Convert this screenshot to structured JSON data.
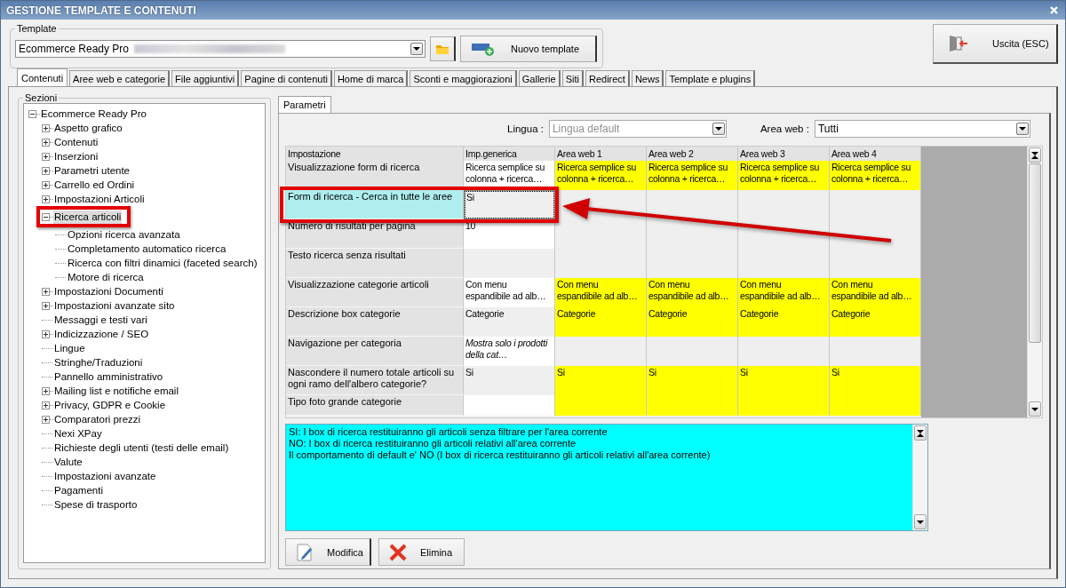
{
  "window": {
    "title": "GESTIONE TEMPLATE E CONTENUTI"
  },
  "template": {
    "label": "Template",
    "value": "Ecommerce Ready Pro"
  },
  "toolbar": {
    "new_template": "Nuovo template",
    "exit": "Uscita (ESC)"
  },
  "tabs": [
    {
      "label": "Contenuti",
      "selected": true
    },
    {
      "label": "Aree web e categorie",
      "selected": false
    },
    {
      "label": "File aggiuntivi",
      "selected": false
    },
    {
      "label": "Pagine di contenuti",
      "selected": false
    },
    {
      "label": "Home di marca",
      "selected": false
    },
    {
      "label": "Sconti e maggiorazioni",
      "selected": false
    },
    {
      "label": "Gallerie",
      "selected": false
    },
    {
      "label": "Siti",
      "selected": false
    },
    {
      "label": "Redirect",
      "selected": false
    },
    {
      "label": "News",
      "selected": false
    },
    {
      "label": "Template e plugins",
      "selected": false
    }
  ],
  "sections": {
    "label": "Sezioni",
    "tree": [
      {
        "label": "Ecommerce Ready Pro",
        "kind": "group",
        "expanded": true,
        "selected": false,
        "children": [
          {
            "label": "Aspetto grafico",
            "kind": "group",
            "expanded": false,
            "selected": false
          },
          {
            "label": "Contenuti",
            "kind": "group",
            "expanded": false,
            "selected": false
          },
          {
            "label": "Inserzioni",
            "kind": "group",
            "expanded": false,
            "selected": false
          },
          {
            "label": "Parametri utente",
            "kind": "group",
            "expanded": false,
            "selected": false
          },
          {
            "label": "Carrello ed Ordini",
            "kind": "group",
            "expanded": false,
            "selected": false
          },
          {
            "label": "Impostazioni Articoli",
            "kind": "group",
            "expanded": false,
            "selected": false
          },
          {
            "label": "Ricerca articoli",
            "kind": "group",
            "expanded": true,
            "selected": true,
            "children": [
              {
                "label": "Opzioni ricerca avanzata",
                "kind": "leaf",
                "selected": false
              },
              {
                "label": "Completamento automatico ricerca",
                "kind": "leaf",
                "selected": false
              },
              {
                "label": "Ricerca con filtri dinamici (faceted search)",
                "kind": "leaf",
                "selected": false
              },
              {
                "label": "Motore di ricerca",
                "kind": "leaf",
                "selected": false
              }
            ]
          },
          {
            "label": "Impostazioni Documenti",
            "kind": "group",
            "expanded": false,
            "selected": false
          },
          {
            "label": "Impostazioni avanzate sito",
            "kind": "group",
            "expanded": false,
            "selected": false
          },
          {
            "label": "Messaggi e testi vari",
            "kind": "leaf",
            "selected": false
          },
          {
            "label": "Indicizzazione / SEO",
            "kind": "group",
            "expanded": false,
            "selected": false
          },
          {
            "label": "Lingue",
            "kind": "leaf",
            "selected": false
          },
          {
            "label": "Stringhe/Traduzioni",
            "kind": "leaf",
            "selected": false
          },
          {
            "label": "Pannello amministrativo",
            "kind": "leaf",
            "selected": false
          },
          {
            "label": "Mailing list e notifiche email",
            "kind": "group",
            "expanded": false,
            "selected": false
          },
          {
            "label": "Privacy, GDPR e Cookie",
            "kind": "group",
            "expanded": false,
            "selected": false
          },
          {
            "label": "Comparatori prezzi",
            "kind": "group",
            "expanded": false,
            "selected": false
          },
          {
            "label": "Nexi XPay",
            "kind": "leaf",
            "selected": false
          },
          {
            "label": "Richieste degli utenti (testi delle email)",
            "kind": "leaf",
            "selected": false
          },
          {
            "label": "Valute",
            "kind": "leaf",
            "selected": false
          },
          {
            "label": "Impostazioni avanzate",
            "kind": "leaf",
            "selected": false
          },
          {
            "label": "Pagamenti",
            "kind": "leaf",
            "selected": false
          },
          {
            "label": "Spese di trasporto",
            "kind": "leaf",
            "selected": false
          }
        ]
      }
    ]
  },
  "panel_tabs": [
    {
      "label": "Parametri",
      "selected": true
    }
  ],
  "filters": {
    "language": {
      "label": "Lingua :",
      "value": "Lingua default",
      "disabled": true
    },
    "area": {
      "label": "Area web :",
      "value": "Tutti",
      "disabled": false
    }
  },
  "grid": {
    "columns": [
      "Impostazione",
      "Imp.generica",
      "Area web 1",
      "Area web 2",
      "Area web 3",
      "Area web 4"
    ],
    "rows": [
      {
        "label": "Visualizzazione form di ricerca",
        "selected": false,
        "generic": {
          "text": "Ricerca semplice su colonna + ricerca…",
          "italic": false
        },
        "areas": [
          {
            "text": "Ricerca semplice su colonna + ricerca…",
            "highlighted": true
          },
          {
            "text": "Ricerca semplice su colonna + ricerca…",
            "highlighted": true
          },
          {
            "text": "Ricerca semplice su colonna + ricerca…",
            "highlighted": true
          },
          {
            "text": "Ricerca semplice su colonna + ricerca…",
            "highlighted": true
          }
        ]
      },
      {
        "label": "Form di ricerca - Cerca in tutte le aree",
        "selected": true,
        "generic": {
          "text": "Si",
          "italic": false
        },
        "areas": [
          {
            "highlighted": false
          },
          {
            "highlighted": false
          },
          {
            "highlighted": false
          },
          {
            "highlighted": false
          }
        ]
      },
      {
        "label": "Numero di risultati per pagina",
        "selected": false,
        "generic": {
          "text": "10",
          "italic": false
        },
        "areas": [
          {
            "highlighted": false
          },
          {
            "highlighted": false
          },
          {
            "highlighted": false
          },
          {
            "highlighted": false
          }
        ]
      },
      {
        "label": "Testo ricerca senza risultati",
        "selected": false,
        "generic": {
          "italic": false
        },
        "areas": [
          {
            "highlighted": false
          },
          {
            "highlighted": false
          },
          {
            "highlighted": false
          },
          {
            "highlighted": false
          }
        ]
      },
      {
        "label": "Visualizzazione categorie articoli",
        "selected": false,
        "generic": {
          "text": "Con menu espandibile ad alb…",
          "italic": false
        },
        "areas": [
          {
            "text": "Con menu espandibile ad alb…",
            "highlighted": true
          },
          {
            "text": "Con menu espandibile ad alb…",
            "highlighted": true
          },
          {
            "text": "Con menu espandibile ad alb…",
            "highlighted": true
          },
          {
            "text": "Con menu espandibile ad alb…",
            "highlighted": true
          }
        ]
      },
      {
        "label": "Descrizione box categorie",
        "selected": false,
        "generic": {
          "text": "Categorie",
          "italic": false
        },
        "areas": [
          {
            "text": "Categorie",
            "highlighted": true
          },
          {
            "text": "Categorie",
            "highlighted": true
          },
          {
            "text": "Categorie",
            "highlighted": true
          },
          {
            "text": "Categorie",
            "highlighted": true
          }
        ]
      },
      {
        "label": "Navigazione per categoria",
        "selected": false,
        "generic": {
          "text": "Mostra solo i prodotti della cat…",
          "italic": true
        },
        "areas": [
          {
            "highlighted": false
          },
          {
            "highlighted": false
          },
          {
            "highlighted": false
          },
          {
            "highlighted": false
          }
        ]
      },
      {
        "label": "Nascondere il numero totale articoli su ogni ramo dell'albero categorie?",
        "selected": false,
        "generic": {
          "text": "Si",
          "italic": false
        },
        "areas": [
          {
            "text": "Si",
            "highlighted": true
          },
          {
            "text": "Si",
            "highlighted": true
          },
          {
            "text": "Si",
            "highlighted": true
          },
          {
            "text": "Si",
            "highlighted": true
          }
        ]
      },
      {
        "label": "Tipo foto grande categorie",
        "selected": false,
        "generic": {
          "italic": false
        },
        "areas": [
          {
            "highlighted": true
          },
          {
            "highlighted": true
          },
          {
            "highlighted": true
          },
          {
            "highlighted": true
          }
        ]
      }
    ]
  },
  "description": [
    "SI: I box di ricerca restituiranno gli articoli senza filtrare per l'area corrente",
    "NO: I box di ricerca restituiranno gli articoli relativi all'area corrente",
    "Il comportamento di default e' NO (I box di ricerca restituiranno gli articoli relativi all'area corrente)"
  ],
  "buttons": [
    "Modifica",
    "Elimina"
  ]
}
